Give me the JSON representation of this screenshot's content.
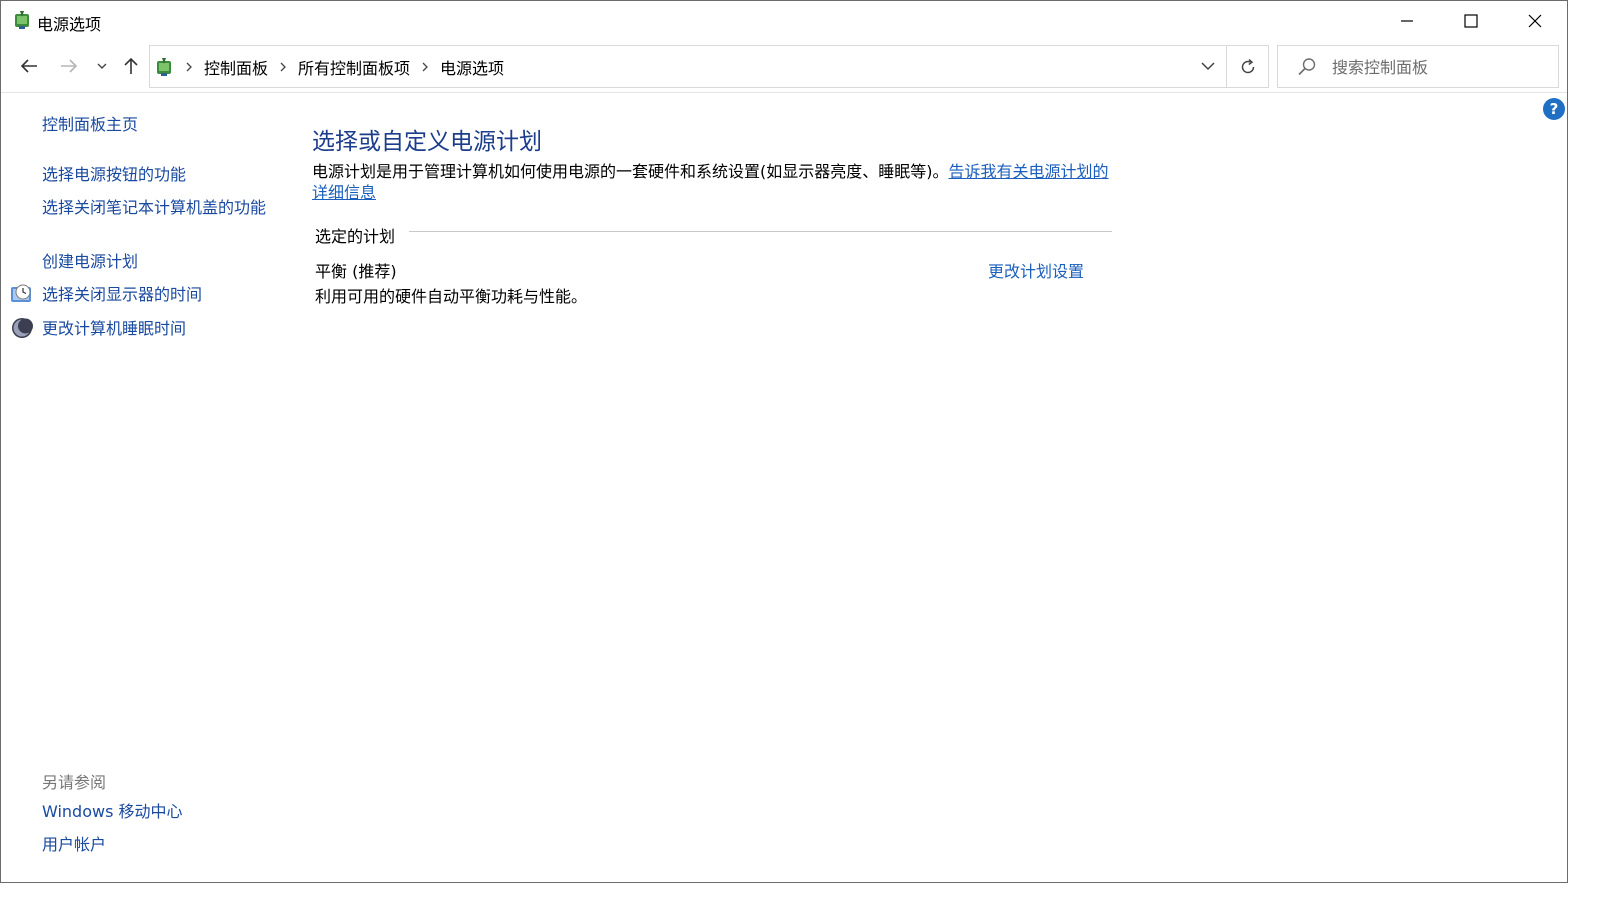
{
  "window": {
    "title": "电源选项"
  },
  "nav": {
    "breadcrumbs": [
      "控制面板",
      "所有控制面板项",
      "电源选项"
    ]
  },
  "search": {
    "placeholder": "搜索控制面板"
  },
  "help": {
    "label": "?"
  },
  "sidebar": {
    "home": "控制面板主页",
    "links": [
      "选择电源按钮的功能",
      "选择关闭笔记本计算机盖的功能",
      "创建电源计划",
      "选择关闭显示器的时间",
      "更改计算机睡眠时间"
    ],
    "see_also_heading": "另请参阅",
    "see_also": [
      "Windows 移动中心",
      "用户帐户"
    ]
  },
  "main": {
    "title": "选择或自定义电源计划",
    "description": "电源计划是用于管理计算机如何使用电源的一套硬件和系统设置(如显示器亮度、睡眠等)。",
    "description_link": "告诉我有关电源计划的详细信息",
    "group_header": "选定的计划",
    "plan": {
      "name": "平衡 (推荐)",
      "description": "利用可用的硬件自动平衡功耗与性能。",
      "change_link": "更改计划设置"
    }
  },
  "colors": {
    "link": "#1a4aa0",
    "title": "#1c3d8c",
    "help": "#1f6fc5"
  }
}
